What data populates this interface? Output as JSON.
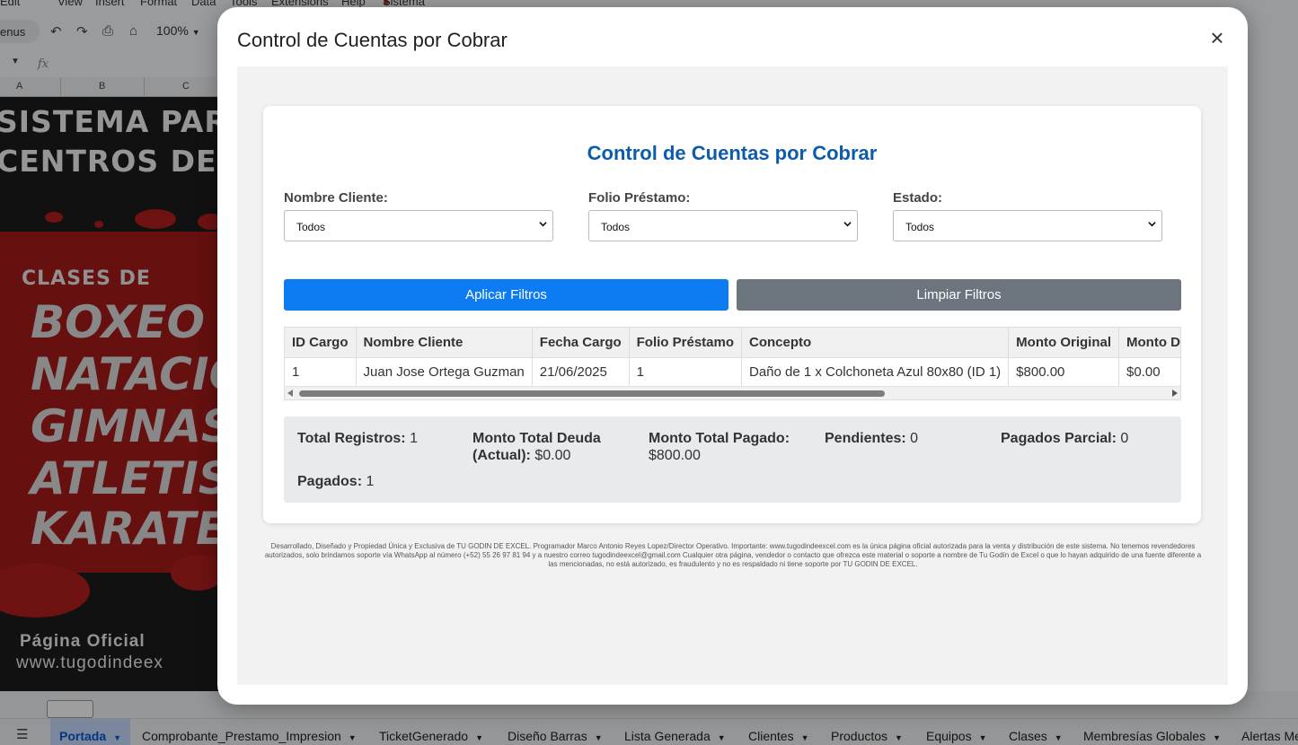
{
  "background": {
    "menu": [
      "Edit",
      "View",
      "Insert",
      "Format",
      "Data",
      "Tools",
      "Extensions",
      "Help",
      "Sistema"
    ],
    "menus_label": "enus",
    "zoom": "100%",
    "columns": [
      "A",
      "B",
      "C"
    ],
    "banner": {
      "headline_1": "SISTEMA PARA",
      "headline_2": "CENTROS DEPOR",
      "subtitle": "CLASES DE",
      "sports": [
        "BOXEO",
        "NATACIO",
        "GIMNASI",
        "ATLETIS",
        "KARATE"
      ],
      "page_label": "Página Oficial",
      "url": "www.tugodindeex"
    },
    "sheet_tabs": [
      "Portada",
      "Comprobante_Prestamo_Impresion",
      "TicketGenerado",
      "Diseño Barras",
      "Lista Generada",
      "Clientes",
      "Productos",
      "Equipos",
      "Clases",
      "Membresías Globales",
      "Alertas Me"
    ]
  },
  "modal": {
    "title": "Control de Cuentas por Cobrar",
    "close_glyph": "×",
    "card_title": "Control de Cuentas por Cobrar",
    "filters": [
      {
        "label": "Nombre Cliente:",
        "value": "Todos"
      },
      {
        "label": "Folio Préstamo:",
        "value": "Todos"
      },
      {
        "label": "Estado:",
        "value": "Todos"
      }
    ],
    "apply_label": "Aplicar Filtros",
    "clear_label": "Limpiar Filtros",
    "table": {
      "headers": [
        "ID Cargo",
        "Nombre Cliente",
        "Fecha Cargo",
        "Folio Préstamo",
        "Concepto",
        "Monto Original",
        "Monto Deuda"
      ],
      "rows": [
        [
          "1",
          "Juan Jose Ortega Guzman",
          "21/06/2025",
          "1",
          "Daño de 1 x Colchoneta Azul 80x80 (ID 1)",
          "$800.00",
          "$0.00"
        ]
      ]
    },
    "summary": {
      "total_registros_label": "Total Registros:",
      "total_registros": "1",
      "monto_deuda_label": "Monto Total Deuda (Actual):",
      "monto_deuda": "$0.00",
      "monto_pagado_label": "Monto Total Pagado:",
      "monto_pagado": "$800.00",
      "pendientes_label": "Pendientes:",
      "pendientes": "0",
      "pagados_parcial_label": "Pagados Parcial:",
      "pagados_parcial": "0",
      "pagados_label": "Pagados:",
      "pagados": "1"
    },
    "footer": "Desarrollado, Diseñado y Propiedad Única y Exclusiva de TU GODIN DE EXCEL. Programador Marco Antonio Reyes Lopez/Director Operativo. Importante: www.tugodindeexcel.com es la única página oficial autorizada para la venta y distribución de este sistema. No tenemos revendedores autorizados, solo brindamos soporte vía WhatsApp al número (+52) 55 26 97 81 94 y a nuestro correo tugodindeexcel@gmail.com Cualquier otra página, vendedor o contacto que ofrezca este material o soporte a nombre de Tu Godín de Excel o que lo hayan adquirido de una fuente diferente a las mencionadas, no está autorizado, es fraudulento y no es respaldado ni tiene soporte por TU GODIN DE EXCEL."
  },
  "colors": {
    "card_title": "#0d5cab",
    "apply_button": "#0d7cf2",
    "clear_button": "#6c757d",
    "banner_red": "#a51b1b"
  }
}
